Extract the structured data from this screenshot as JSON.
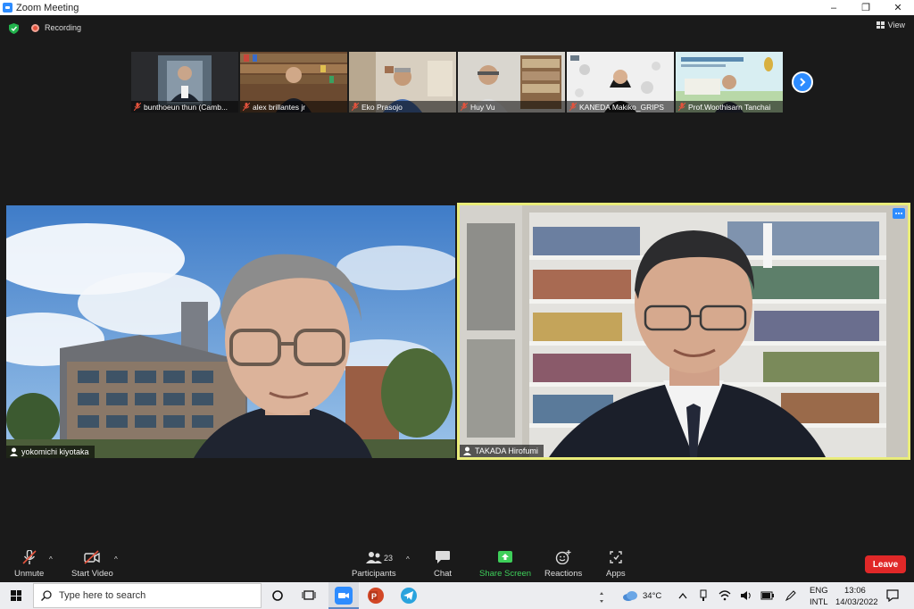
{
  "window": {
    "title": "Zoom Meeting",
    "minimize": "–",
    "restore": "❐",
    "close": "✕"
  },
  "topbar": {
    "recording_label": "Recording",
    "view_label": "View"
  },
  "filmstrip": {
    "participants": [
      {
        "name": "bunthoeun thun (Camb..."
      },
      {
        "name": "alex brillantes jr"
      },
      {
        "name": "Eko Prasojo"
      },
      {
        "name": "Huy Vu"
      },
      {
        "name": "KANEDA Makiko_GRIPS"
      },
      {
        "name": "Prof.Woothisarn Tanchai"
      }
    ]
  },
  "main_tiles": {
    "left": {
      "name": "yokomichi kiyotaka"
    },
    "right": {
      "name": "TAKADA Hirofumi"
    }
  },
  "toolbar": {
    "unmute_label": "Unmute",
    "start_video_label": "Start Video",
    "participants_label": "Participants",
    "participants_count": "23",
    "chat_label": "Chat",
    "share_screen_label": "Share Screen",
    "reactions_label": "Reactions",
    "apps_label": "Apps",
    "leave_label": "Leave",
    "caret": "^"
  },
  "taskbar": {
    "search_placeholder": "Type here to search",
    "weather": "34°C",
    "language_line1": "ENG",
    "language_line2": "INTL",
    "time": "13:06",
    "date": "14/03/2022"
  },
  "colors": {
    "accent": "#2d8cff",
    "leave": "#e02828",
    "active_speaker_border": "#e9ec7a",
    "share_green": "#3ecf5a",
    "muted_red": "#e5533d"
  }
}
